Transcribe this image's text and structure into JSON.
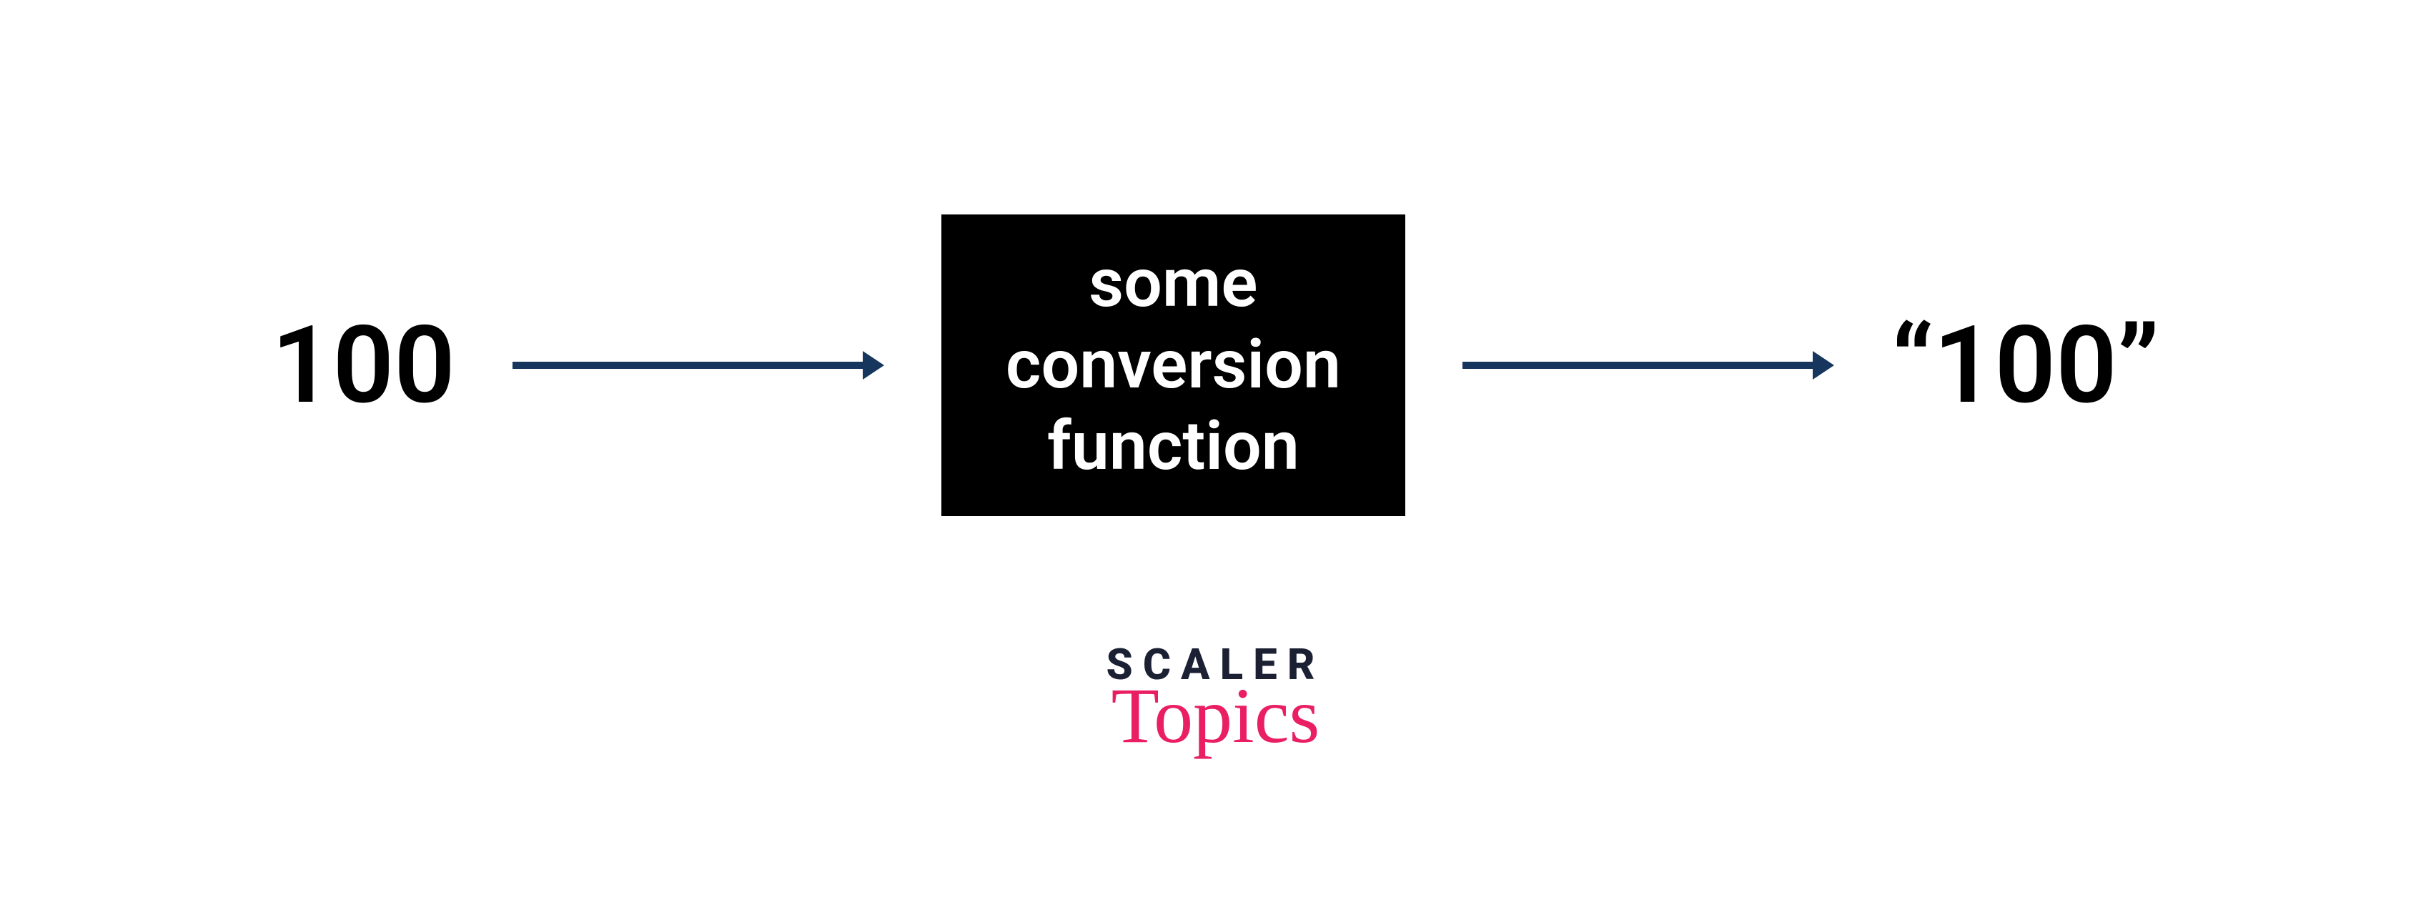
{
  "diagram": {
    "input": "100",
    "box_line1": "some",
    "box_line2": "conversion",
    "box_line3": "function",
    "output": "“100”"
  },
  "colors": {
    "arrow": "#17365d",
    "box_bg": "#000000",
    "box_fg": "#ffffff",
    "logo_dark": "#1b2033",
    "logo_pink": "#e91e63"
  },
  "logo": {
    "line1": "SCALER",
    "line2": "Topics"
  }
}
